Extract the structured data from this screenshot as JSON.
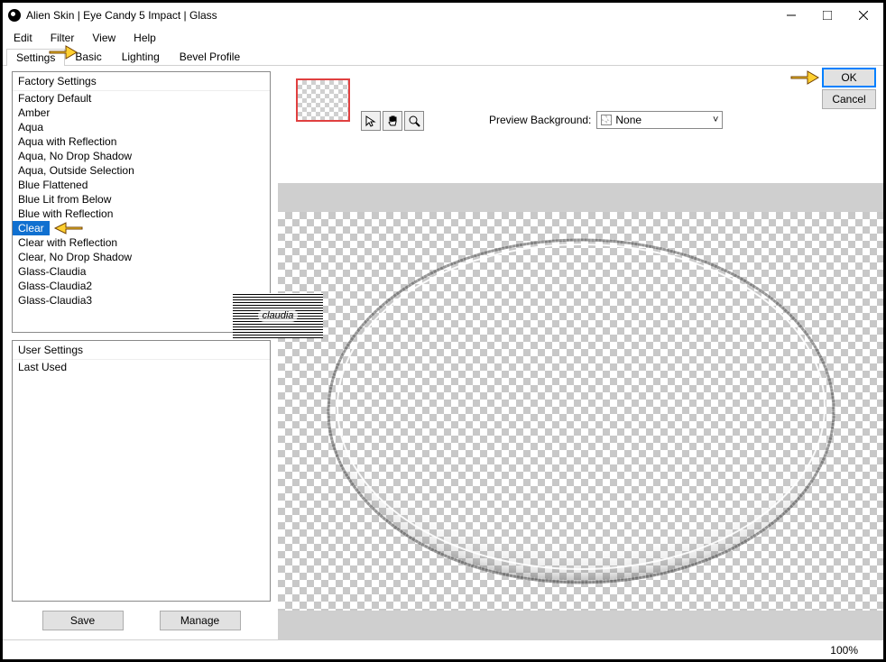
{
  "window": {
    "title": "Alien Skin | Eye Candy 5 Impact | Glass"
  },
  "menu": {
    "items": [
      "Edit",
      "Filter",
      "View",
      "Help"
    ]
  },
  "tabs": {
    "items": [
      "Settings",
      "Basic",
      "Lighting",
      "Bevel Profile"
    ],
    "active_index": 0
  },
  "factory_settings": {
    "header": "Factory Settings",
    "items": [
      "Factory Default",
      "Amber",
      "Aqua",
      "Aqua with Reflection",
      "Aqua, No Drop Shadow",
      "Aqua, Outside Selection",
      "Blue Flattened",
      "Blue Lit from Below",
      "Blue with Reflection",
      "Clear",
      "Clear with Reflection",
      "Clear, No Drop Shadow",
      "Glass-Claudia",
      "Glass-Claudia2",
      "Glass-Claudia3"
    ],
    "selected_index": 9
  },
  "user_settings": {
    "header": "User Settings",
    "items": [
      "Last Used"
    ]
  },
  "buttons": {
    "save": "Save",
    "manage": "Manage",
    "ok": "OK",
    "cancel": "Cancel"
  },
  "preview_bg": {
    "label": "Preview Background:",
    "value": "None"
  },
  "status": {
    "zoom": "100%"
  },
  "watermark": "claudia",
  "icons": {
    "pointer": "pointer-icon",
    "hand": "hand-icon",
    "zoom": "zoom-icon"
  }
}
